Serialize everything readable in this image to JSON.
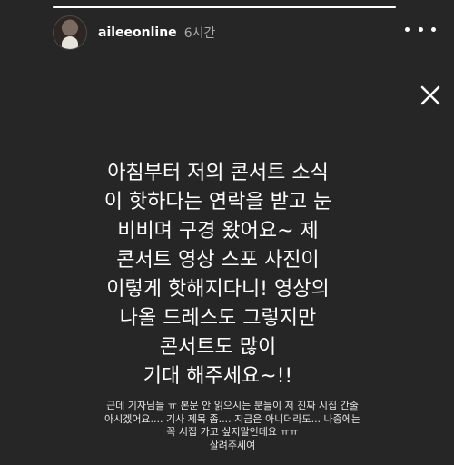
{
  "story": {
    "progress": 1.0,
    "user": {
      "username": "aileeonline",
      "time": "6시간",
      "avatar_icon": "profile-photo"
    },
    "actions": {
      "more_icon": "more-horizontal-icon",
      "close_icon": "close-icon"
    },
    "caption": {
      "lines": [
        "아침부터 저의 콘서트 소식",
        "이 핫하다는 연락을 받고 눈",
        "비비며 구경 왔어요~ 제",
        "콘서트 영상 스포 사진이",
        "이렇게 핫해지다니! 영상의",
        "나올 드레스도 그렇지만",
        "콘서트도 많이",
        "기대 해주세요~!!"
      ]
    },
    "subcaption": {
      "lines": [
        "근데 기자님들 ㅠ 본문 안 읽으시는 분들이 저 진짜 시집 간줄",
        "아시겠어요.... 기사 제목 좀.... 지금은 아니더라도... 나중에는",
        "꼭 시집 가고 싶지말인데요 ㅠㅠ",
        "살려주세여"
      ]
    },
    "colors": {
      "background": "#262626",
      "text": "#ffffff",
      "muted": "#a8a8a8"
    }
  }
}
